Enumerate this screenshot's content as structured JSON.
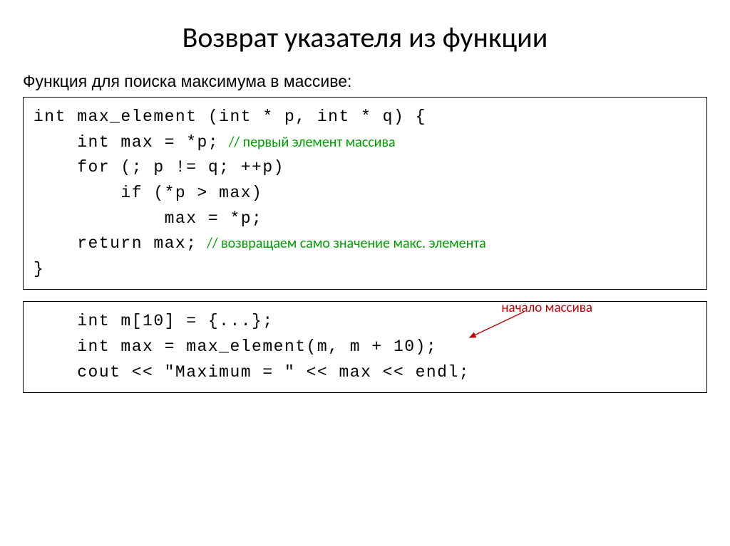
{
  "title": "Возврат указателя из функции",
  "subtitle": "Функция для поиска максимума в массиве:",
  "code1": {
    "l1": "int max_element (int * p, int * q) {",
    "l2": "    int max = *p;",
    "c2": "   // первый элемент массива",
    "l3": "    for (; p != q; ++p)",
    "l4": "        if (*p > max)",
    "l5": "            max = *p;",
    "l6": "",
    "l7": "    return max;",
    "c7": "   // возвращаем само значение макс. элемента",
    "l8": "}"
  },
  "code2": {
    "l1": "    int m[10] = {...};",
    "l2": "    int max = max_element(m, m + 10);",
    "l3": "    cout << \"Maximum = \" << max << endl;"
  },
  "annot": "начало массива"
}
